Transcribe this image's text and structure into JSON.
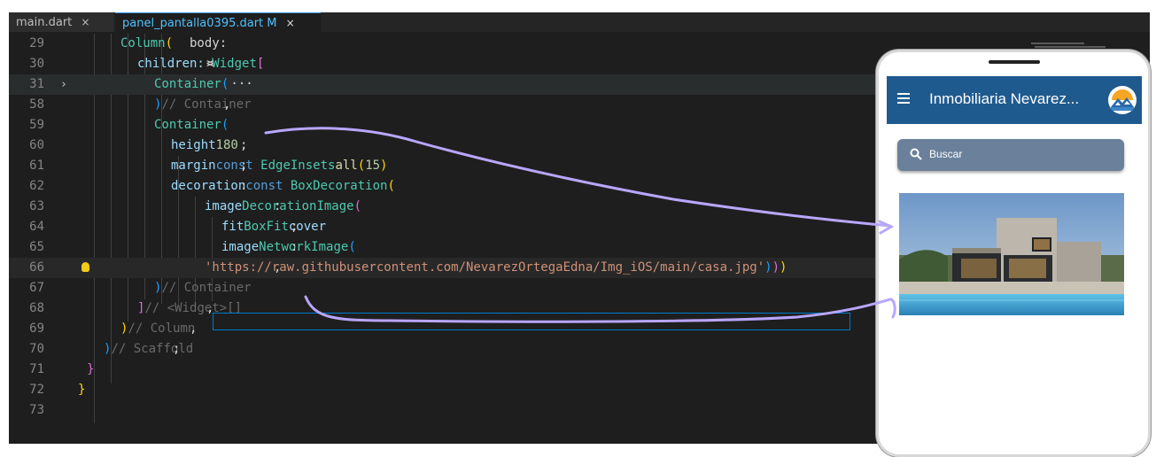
{
  "tabs": [
    {
      "label": "main.dart",
      "close": "×"
    },
    {
      "label": "panel_pantalla0395.dart M",
      "close": "×"
    }
  ],
  "editor": {
    "lines": [
      {
        "num": "29",
        "tokens": [
          [
            "txt",
            "body: "
          ],
          [
            "cls",
            "Column"
          ],
          [
            "b1",
            "("
          ]
        ]
      },
      {
        "num": "30",
        "tokens": [
          [
            "prop",
            "children: "
          ],
          [
            "txt",
            "<"
          ],
          [
            "cls",
            "Widget"
          ],
          [
            "txt",
            ">"
          ],
          [
            "b2",
            "["
          ]
        ]
      },
      {
        "num": "31",
        "tokens": [
          [
            "cls",
            "Container"
          ],
          [
            "b3",
            "("
          ],
          [
            "txt",
            " ···"
          ]
        ]
      },
      {
        "num": "58",
        "tokens": [
          [
            "b3",
            ")"
          ],
          [
            "txt",
            ", "
          ],
          [
            "cmt",
            "// Container"
          ]
        ]
      },
      {
        "num": "59",
        "tokens": [
          [
            "cls",
            "Container"
          ],
          [
            "b3",
            "("
          ]
        ]
      },
      {
        "num": "60",
        "tokens": [
          [
            "prop",
            "height"
          ],
          [
            "txt",
            ": "
          ],
          [
            "num",
            "180"
          ],
          [
            "txt",
            ","
          ]
        ]
      },
      {
        "num": "61",
        "tokens": [
          [
            "prop",
            "margin"
          ],
          [
            "txt",
            ": "
          ],
          [
            "kw",
            "const "
          ],
          [
            "cls",
            "EdgeInsets"
          ],
          [
            "txt",
            "."
          ],
          [
            "fn",
            "all"
          ],
          [
            "b1",
            "("
          ],
          [
            "num",
            "15"
          ],
          [
            "b1",
            ")"
          ],
          [
            "txt",
            ","
          ]
        ]
      },
      {
        "num": "62",
        "tokens": [
          [
            "prop",
            "decoration"
          ],
          [
            "txt",
            ": "
          ],
          [
            "kw",
            "const "
          ],
          [
            "cls",
            "BoxDecoration"
          ],
          [
            "b1",
            "("
          ]
        ]
      },
      {
        "num": "63",
        "tokens": [
          [
            "prop",
            "image"
          ],
          [
            "txt",
            ": "
          ],
          [
            "cls",
            "DecorationImage"
          ],
          [
            "b2",
            "("
          ]
        ]
      },
      {
        "num": "64",
        "tokens": [
          [
            "prop",
            "fit"
          ],
          [
            "txt",
            ": "
          ],
          [
            "cls",
            "BoxFit"
          ],
          [
            "txt",
            "."
          ],
          [
            "prop",
            "cover"
          ],
          [
            "txt",
            ","
          ]
        ]
      },
      {
        "num": "65",
        "tokens": [
          [
            "prop",
            "image"
          ],
          [
            "txt",
            ": "
          ],
          [
            "cls",
            "NetworkImage"
          ],
          [
            "b3",
            "("
          ]
        ]
      },
      {
        "num": "66",
        "tokens": [
          [
            "str",
            "'https://raw.githubusercontent.com/NevarezOrtegaEdna/Img_iOS/main/casa.jpg'"
          ],
          [
            "b3",
            ")"
          ],
          [
            "b2",
            ")"
          ],
          [
            "b1",
            ")"
          ],
          [
            "txt",
            ","
          ]
        ]
      },
      {
        "num": "67",
        "tokens": [
          [
            "b3",
            ")"
          ],
          [
            "txt",
            " "
          ],
          [
            "cmt",
            "// Container"
          ]
        ]
      },
      {
        "num": "68",
        "tokens": [
          [
            "b2",
            "]"
          ],
          [
            "txt",
            ", "
          ],
          [
            "cmt",
            "// <Widget>[]"
          ]
        ]
      },
      {
        "num": "69",
        "tokens": [
          [
            "b1",
            ")"
          ],
          [
            "txt",
            ", "
          ],
          [
            "cmt",
            "// Column"
          ]
        ]
      },
      {
        "num": "70",
        "tokens": [
          [
            "b3",
            ")"
          ],
          [
            "txt",
            "; "
          ],
          [
            "cmt",
            "// Scaffold"
          ]
        ]
      },
      {
        "num": "71",
        "tokens": [
          [
            "b2",
            "}"
          ]
        ]
      },
      {
        "num": "72",
        "tokens": [
          [
            "b1",
            "}"
          ]
        ]
      },
      {
        "num": "73",
        "tokens": []
      }
    ]
  },
  "phone": {
    "app_title": "Inmobiliaria Nevarez...",
    "search_placeholder": "Buscar",
    "icons": {
      "menu": "hamburger-menu-icon",
      "search": "search-icon",
      "logo": "mountain-logo-icon"
    }
  },
  "colors": {
    "editor_bg": "#1e1e1e",
    "appbar": "#1f5a8f",
    "search_bar": "#6b809a",
    "annotation_arrow": "#b9a6ff"
  }
}
